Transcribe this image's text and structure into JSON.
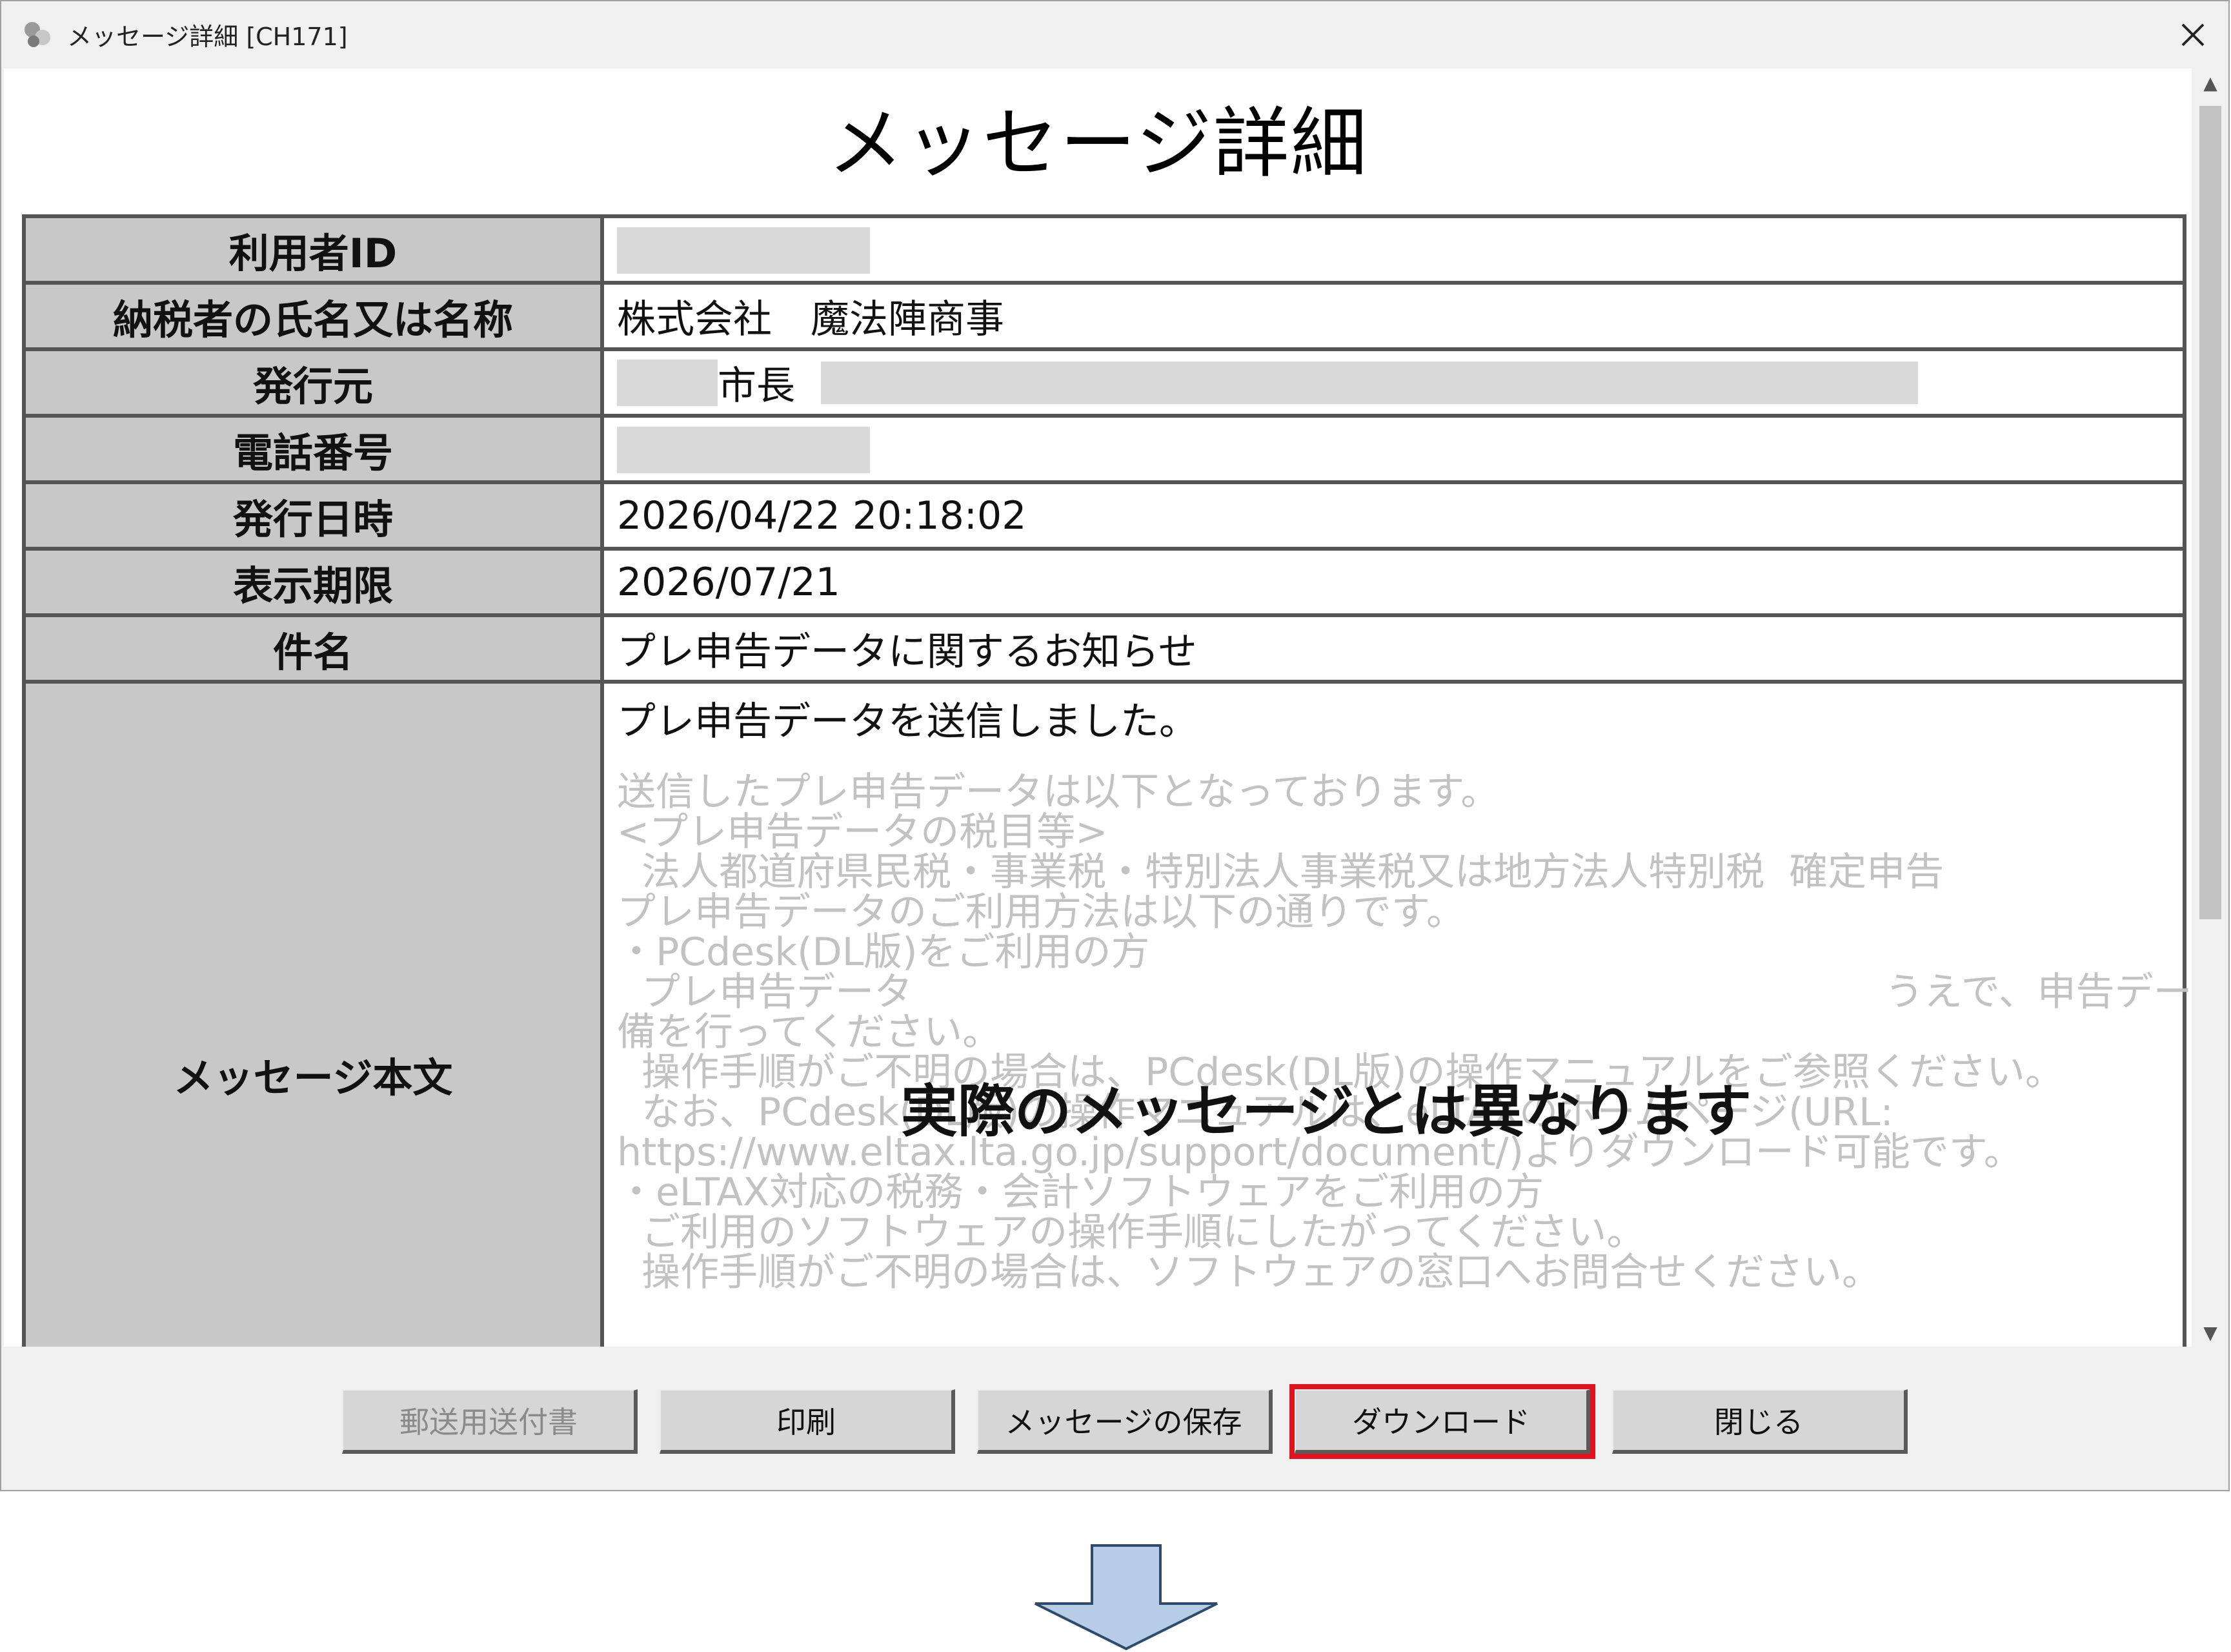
{
  "window": {
    "title": "メッセージ詳細 [CH171]",
    "close_glyph": "✕"
  },
  "page_title": "メッセージ詳細",
  "details": {
    "user_id_label": "利用者ID",
    "user_id_value": "",
    "taxpayer_label": "納税者の氏名又は名称",
    "taxpayer_value": "株式会社　魔法陣商事",
    "issuer_label": "発行元",
    "issuer_value": "市長",
    "phone_label": "電話番号",
    "phone_value": "",
    "issued_at_label": "発行日時",
    "issued_at_value": "2026/04/22 20:18:02",
    "display_deadline_label": "表示期限",
    "display_deadline_value": "2026/07/21",
    "subject_label": "件名",
    "subject_value": "プレ申告データに関するお知らせ",
    "body_label": "メッセージ本文",
    "body_first_line": "プレ申告データを送信しました。",
    "body_lines": [
      "送信したプレ申告データは以下となっております。",
      "<プレ申告データの税目等>",
      "  法人都道府県民税・事業税・特別法人事業税又は地方法人特別税  確定申告",
      "",
      "プレ申告データのご利用方法は以下の通りです。",
      "・PCdesk(DL版)をご利用の方",
      "  プレ申告データ                                                                               うえで、申告データの準",
      "備を行ってください。",
      "  操作手順がご不明の場合は、PCdesk(DL版)の操作マニュアルをご参照ください。",
      "  なお、PCdesk(DL版)の操作マニュアルは、eLTAXのホームページ(URL:",
      "https://www.eltax.lta.go.jp/support/document/)よりダウンロード可能です。",
      "",
      "・eLTAX対応の税務・会計ソフトウェアをご利用の方",
      "  ご利用のソフトウェアの操作手順にしたがってください。",
      "  操作手順がご不明の場合は、ソフトウェアの窓口へお問合せください。"
    ]
  },
  "overlay_note": "実際のメッセージとは異なります",
  "buttons": {
    "mail_cover": "郵送用送付書",
    "print": "印刷",
    "save_message": "メッセージの保存",
    "download": "ダウンロード",
    "close": "閉じる"
  },
  "scrollbar": {
    "up_glyph": "▲",
    "down_glyph": "▼"
  },
  "colors": {
    "label_bg": "#c8c8c8",
    "highlight": "#e0121b",
    "arrow_fill": "#b7cde7",
    "arrow_stroke": "#2f4a6b"
  }
}
